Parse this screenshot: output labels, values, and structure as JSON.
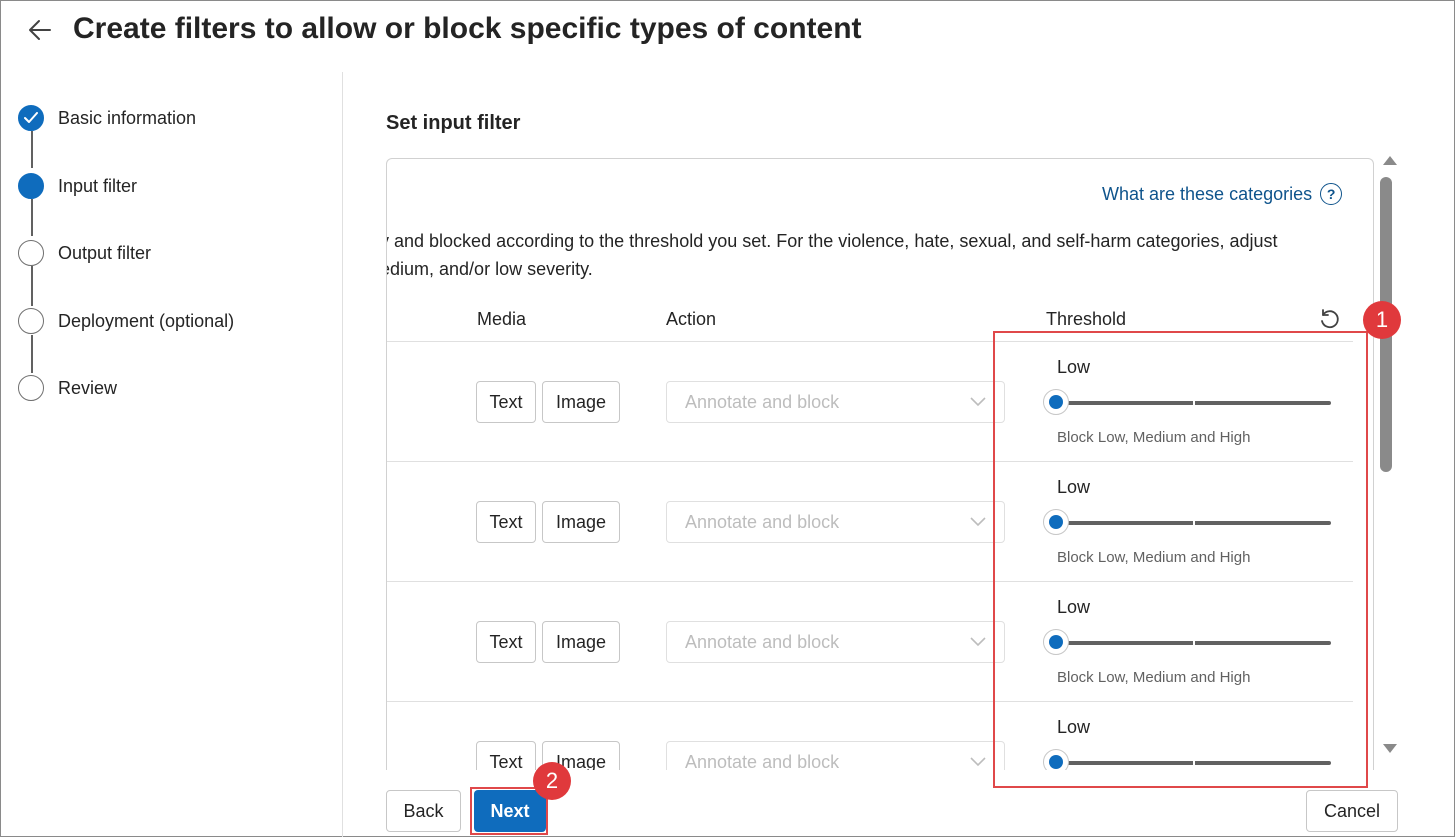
{
  "header": {
    "title": "Create filters to allow or block specific types of content"
  },
  "steps": [
    {
      "label": "Basic information",
      "state": "done"
    },
    {
      "label": "Input filter",
      "state": "current"
    },
    {
      "label": "Output filter",
      "state": "pending"
    },
    {
      "label": "Deployment (optional)",
      "state": "pending"
    },
    {
      "label": "Review",
      "state": "pending"
    }
  ],
  "main": {
    "section_title": "Set input filter",
    "help_link": "What are these categories",
    "description_line1": "y and blocked according to the threshold you set. For the violence, hate, sexual, and self-harm categories, adjust",
    "description_line2": "edium, and/or low severity.",
    "columns": {
      "media": "Media",
      "action": "Action",
      "threshold": "Threshold"
    },
    "rows": [
      {
        "media": [
          "Text",
          "Image"
        ],
        "action": "Annotate and block",
        "threshold_label": "Low",
        "threshold_desc": "Block Low, Medium and High",
        "level": 0
      },
      {
        "media": [
          "Text",
          "Image"
        ],
        "action": "Annotate and block",
        "threshold_label": "Low",
        "threshold_desc": "Block Low, Medium and High",
        "level": 0
      },
      {
        "media": [
          "Text",
          "Image"
        ],
        "action": "Annotate and block",
        "threshold_label": "Low",
        "threshold_desc": "Block Low, Medium and High",
        "level": 0
      },
      {
        "media": [
          "Text",
          "Image"
        ],
        "action": "Annotate and block",
        "threshold_label": "Low",
        "threshold_desc": "",
        "level": 0
      }
    ]
  },
  "footer": {
    "back": "Back",
    "next": "Next",
    "cancel": "Cancel"
  },
  "annotations": [
    {
      "label": "1"
    },
    {
      "label": "2"
    }
  ],
  "colors": {
    "accent": "#0f6cbd",
    "annotation": "#e0393c",
    "link": "#0f548c"
  }
}
